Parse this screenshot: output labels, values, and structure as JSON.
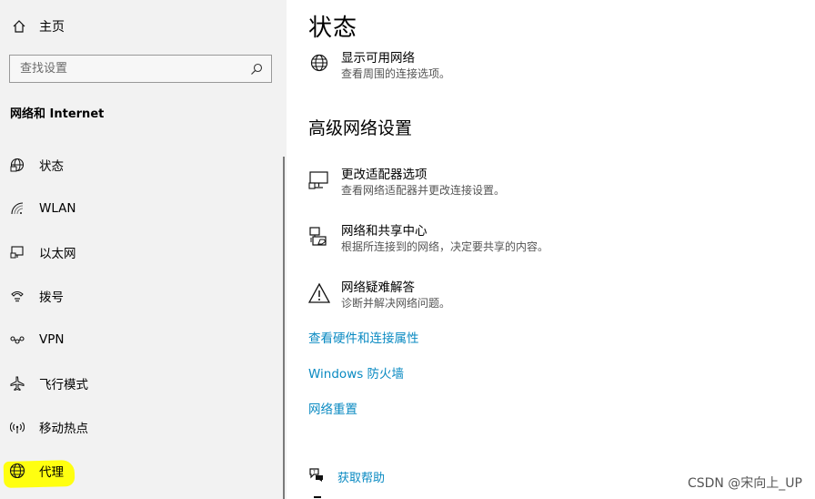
{
  "sidebar": {
    "home_label": "主页",
    "search_placeholder": "查找设置",
    "section_title": "网络和 Internet",
    "items": [
      {
        "label": "状态",
        "icon": "globe-status-icon"
      },
      {
        "label": "WLAN",
        "icon": "wifi-icon"
      },
      {
        "label": "以太网",
        "icon": "ethernet-icon"
      },
      {
        "label": "拨号",
        "icon": "dialup-icon"
      },
      {
        "label": "VPN",
        "icon": "vpn-icon"
      },
      {
        "label": "飞行模式",
        "icon": "airplane-icon"
      },
      {
        "label": "移动热点",
        "icon": "hotspot-icon"
      },
      {
        "label": "代理",
        "icon": "globe-icon",
        "highlighted": true
      }
    ]
  },
  "main": {
    "title": "状态",
    "show_networks": {
      "title": "显示可用网络",
      "desc": "查看周围的连接选项。"
    },
    "advanced_heading": "高级网络设置",
    "advanced_items": [
      {
        "title": "更改适配器选项",
        "desc": "查看网络适配器并更改连接设置。",
        "icon": "adapter-icon"
      },
      {
        "title": "网络和共享中心",
        "desc": "根据所连接到的网络，决定要共享的内容。",
        "icon": "sharing-center-icon"
      },
      {
        "title": "网络疑难解答",
        "desc": "诊断并解决网络问题。",
        "icon": "warning-icon"
      }
    ],
    "links": [
      "查看硬件和连接属性",
      "Windows 防火墙",
      "网络重置"
    ],
    "help_label": "获取帮助"
  },
  "watermark": "CSDN @宋向上_UP",
  "colors": {
    "link": "#0a8ac2",
    "sidebar_bg": "#f2f2f2",
    "highlight": "#ffff10"
  }
}
